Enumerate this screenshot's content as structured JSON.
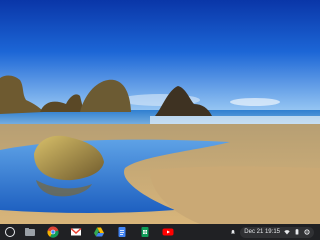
{
  "wallpaper": {
    "name": "beach-sea-stacks"
  },
  "shelf": {
    "launcher_icon": "launcher-icon",
    "apps": [
      {
        "name": "files-icon"
      },
      {
        "name": "chrome-icon"
      },
      {
        "name": "gmail-icon"
      },
      {
        "name": "drive-icon"
      },
      {
        "name": "docs-icon"
      },
      {
        "name": "sheets-icon"
      },
      {
        "name": "youtube-icon"
      }
    ],
    "tray": {
      "date_time": "Dec 21  19:15",
      "icons": [
        "notification-icon",
        "wifi-icon",
        "battery-icon",
        "settings-icon"
      ]
    }
  },
  "colors": {
    "shelf_bg": "#202124",
    "sky_top": "#0d3fb8",
    "sky_bottom": "#8fc5f4",
    "sand": "#d2b47c"
  }
}
